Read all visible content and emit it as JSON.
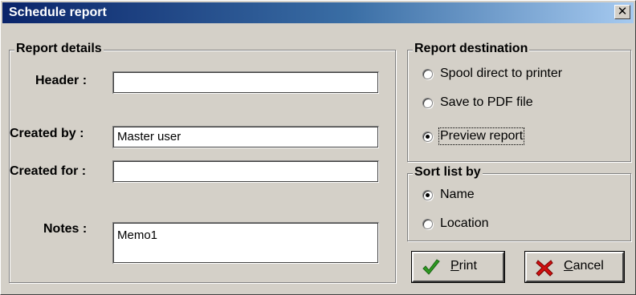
{
  "window": {
    "title": "Schedule report",
    "close_glyph": "✕"
  },
  "report_details": {
    "legend": "Report details",
    "header_label": "Header :",
    "header_value": "",
    "created_by_label": "Created by :",
    "created_by_value": "Master user",
    "created_for_label": "Created for :",
    "created_for_value": "",
    "notes_label": "Notes :",
    "notes_value": "Memo1"
  },
  "report_destination": {
    "legend": "Report destination",
    "options": [
      {
        "label": "Spool direct to printer",
        "checked": false
      },
      {
        "label": "Save to PDF file",
        "checked": false
      },
      {
        "label": "Preview report",
        "checked": true
      }
    ]
  },
  "sort_list": {
    "legend": "Sort list by",
    "options": [
      {
        "label": "Name",
        "checked": true
      },
      {
        "label": "Location",
        "checked": false
      }
    ]
  },
  "buttons": {
    "print": {
      "accel": "P",
      "rest": "rint",
      "icon": "check-icon",
      "color": "#2e9b22"
    },
    "cancel": {
      "accel": "C",
      "rest": "ancel",
      "icon": "cross-icon",
      "color": "#d01010"
    }
  }
}
